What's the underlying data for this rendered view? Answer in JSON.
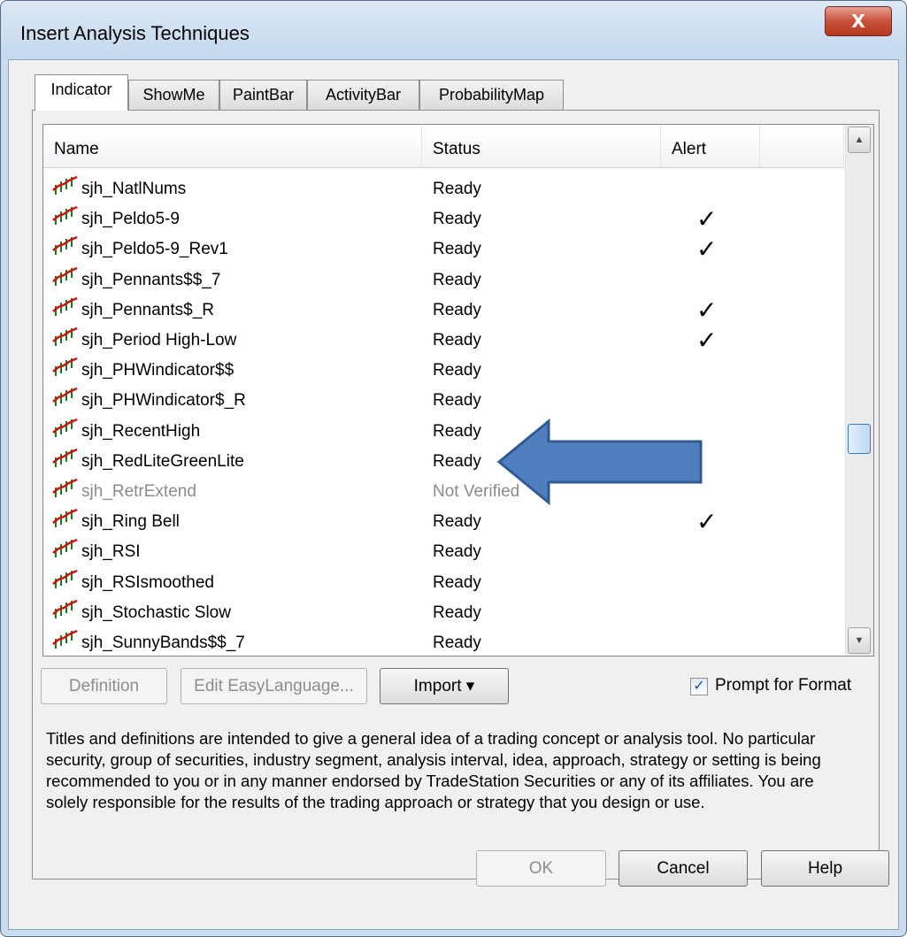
{
  "window": {
    "title": "Insert Analysis Techniques",
    "close_glyph": "X"
  },
  "tabs": [
    "Indicator",
    "ShowMe",
    "PaintBar",
    "ActivityBar",
    "ProbabilityMap"
  ],
  "list": {
    "columns": [
      "Name",
      "Status",
      "Alert"
    ],
    "rows": [
      {
        "name": "sjh_NatlNums",
        "status": "Ready",
        "alert": ""
      },
      {
        "name": "sjh_Peldo5-9",
        "status": "Ready",
        "alert": "✓"
      },
      {
        "name": "sjh_Peldo5-9_Rev1",
        "status": "Ready",
        "alert": "✓"
      },
      {
        "name": "sjh_Pennants$$_7",
        "status": "Ready",
        "alert": ""
      },
      {
        "name": "sjh_Pennants$_R",
        "status": "Ready",
        "alert": "✓"
      },
      {
        "name": "sjh_Period High-Low",
        "status": "Ready",
        "alert": "✓"
      },
      {
        "name": "sjh_PHWindicator$$",
        "status": "Ready",
        "alert": ""
      },
      {
        "name": "sjh_PHWindicator$_R",
        "status": "Ready",
        "alert": ""
      },
      {
        "name": "sjh_RecentHigh",
        "status": "Ready",
        "alert": ""
      },
      {
        "name": "sjh_RedLiteGreenLite",
        "status": "Ready",
        "alert": ""
      },
      {
        "name": "sjh_RetrExtend",
        "status": "Not Verified",
        "alert": ""
      },
      {
        "name": "sjh_Ring Bell",
        "status": "Ready",
        "alert": "✓"
      },
      {
        "name": "sjh_RSI",
        "status": "Ready",
        "alert": ""
      },
      {
        "name": "sjh_RSIsmoothed",
        "status": "Ready",
        "alert": ""
      },
      {
        "name": "sjh_Stochastic Slow",
        "status": "Ready",
        "alert": ""
      },
      {
        "name": "sjh_SunnyBands$$_7",
        "status": "Ready",
        "alert": ""
      }
    ]
  },
  "buttons": {
    "definition": "Definition",
    "edit_easylanguage": "Edit EasyLanguage...",
    "import": "Import ▾",
    "ok": "OK",
    "cancel": "Cancel",
    "help": "Help"
  },
  "prompt_for_format": {
    "label": "Prompt for Format",
    "checked": true
  },
  "disclaimer": "Titles and definitions are intended to give a general idea of a trading concept or analysis tool. No particular security, group of securities, industry segment, analysis interval, idea, approach, strategy or setting is being recommended to you or in any manner endorsed by TradeStation Securities or any of its affiliates. You are solely responsible for the results of the trading approach or strategy that you design or use.",
  "colors": {
    "arrow": "#4f7fbf",
    "indicator_icon": "#d01010"
  },
  "icons": {
    "indicator": "indicator-chart-icon",
    "arrow": "left-arrow-annotation"
  }
}
